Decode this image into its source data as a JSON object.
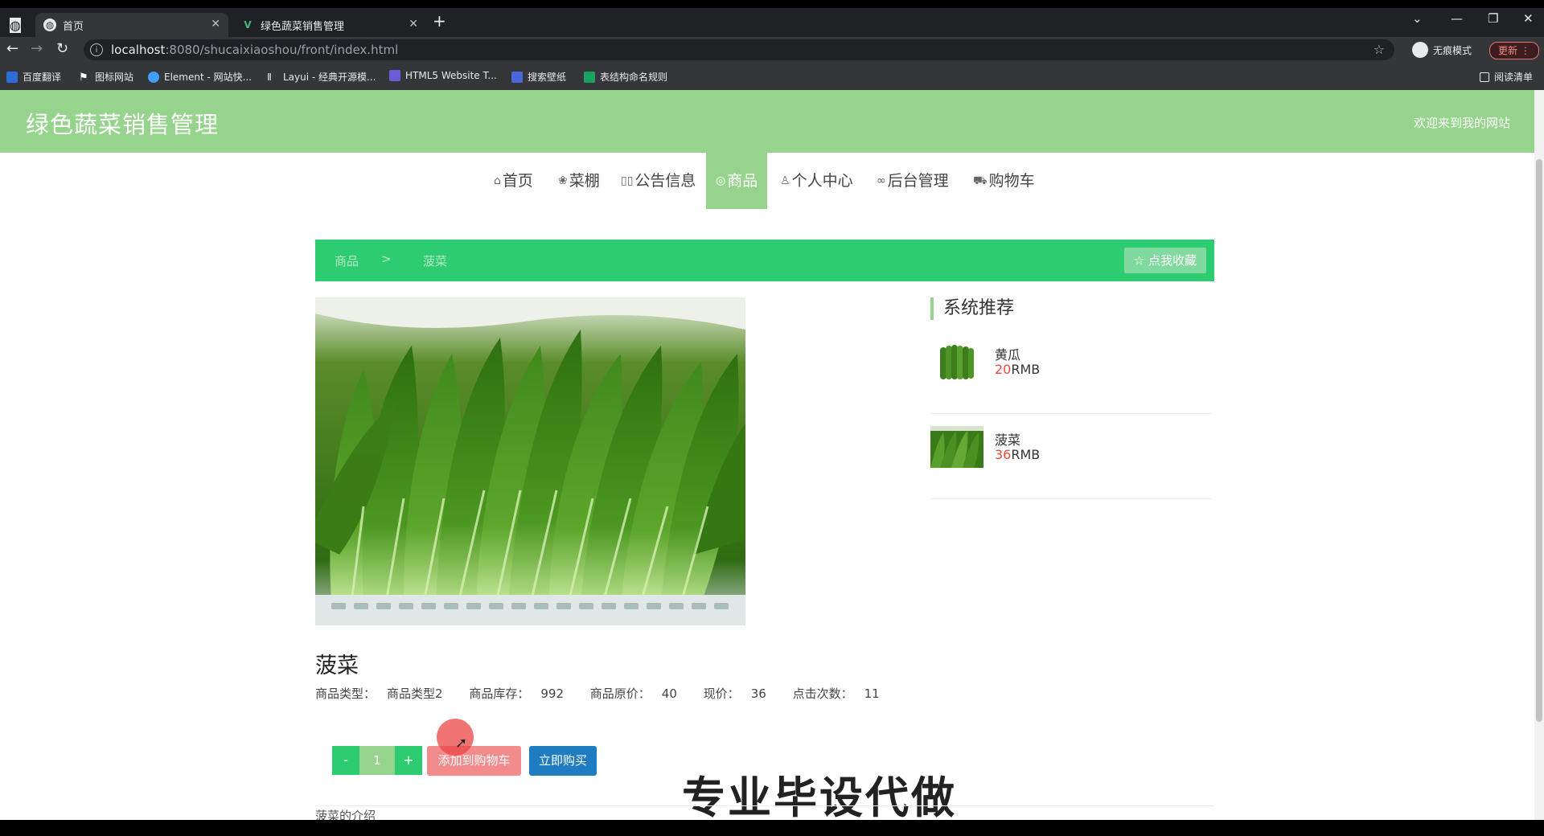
{
  "browser": {
    "tabs": [
      {
        "title": "首页",
        "active": true
      },
      {
        "title": "绿色蔬菜销售管理",
        "active": false
      }
    ],
    "url_host": "localhost",
    "url_rest": ":8080/shucaixiaoshou/front/index.html",
    "incognito_label": "无痕模式",
    "update_label": "更新",
    "bookmarks": [
      {
        "label": "百度翻译",
        "color": "#2b6cd8"
      },
      {
        "label": "图标网站",
        "color": "#ffffff"
      },
      {
        "label": "Element - 网站快...",
        "color": "#409eff"
      },
      {
        "label": "Layui - 经典开源模...",
        "color": "#e8eaed"
      },
      {
        "label": "HTML5 Website T...",
        "color": "#6b5bd6"
      },
      {
        "label": "搜索壁纸",
        "color": "#4a66d9"
      },
      {
        "label": "表结构命名规则",
        "color": "#1aa260"
      }
    ],
    "reading_list": "阅读清单"
  },
  "site": {
    "title": "绿色蔬菜销售管理",
    "welcome": "欢迎来到我的网站"
  },
  "nav": [
    {
      "label": "首页",
      "icon": "home-icon",
      "glyph": "⌂"
    },
    {
      "label": "菜棚",
      "icon": "greenhouse-icon",
      "glyph": "❀"
    },
    {
      "label": "公告信息",
      "icon": "notice-icon",
      "glyph": "▯▯"
    },
    {
      "label": "商品",
      "icon": "goods-icon",
      "glyph": "◎",
      "active": true
    },
    {
      "label": "个人中心",
      "icon": "user-icon",
      "glyph": "♙"
    },
    {
      "label": "后台管理",
      "icon": "link-icon",
      "glyph": "∞"
    },
    {
      "label": "购物车",
      "icon": "cart-icon",
      "glyph": "⛟"
    }
  ],
  "breadcrumb": {
    "parent": "商品",
    "separator": ">",
    "current": "菠菜",
    "favorite_label": "☆ 点我收藏"
  },
  "sidebar": {
    "title": "系统推荐",
    "items": [
      {
        "name": "黄瓜",
        "price": "20",
        "unit": "RMB"
      },
      {
        "name": "菠菜",
        "price": "36",
        "unit": "RMB"
      }
    ]
  },
  "product": {
    "name": "菠菜",
    "type_label": "商品类型：",
    "type_value": "商品类型2",
    "stock_label": "商品库存：",
    "stock_value": "992",
    "orig_price_label": "商品原价：",
    "orig_price_value": "40",
    "price_label": "现价：",
    "price_value": "36",
    "clicks_label": "点击次数：",
    "clicks_value": "11",
    "quantity": "1",
    "minus": "-",
    "plus": "+",
    "add_cart_label": "添加到购物车",
    "buy_label": "立即购买",
    "intro_title": "菠菜的介绍"
  },
  "overlay": {
    "watermark": "专业毕设代做"
  },
  "colors": {
    "header_green": "#96d38c",
    "crumb_green": "#2ecc71",
    "cart_red": "#f28b8b",
    "buy_blue": "#1f7cc1",
    "price_red": "#e74c3c"
  }
}
